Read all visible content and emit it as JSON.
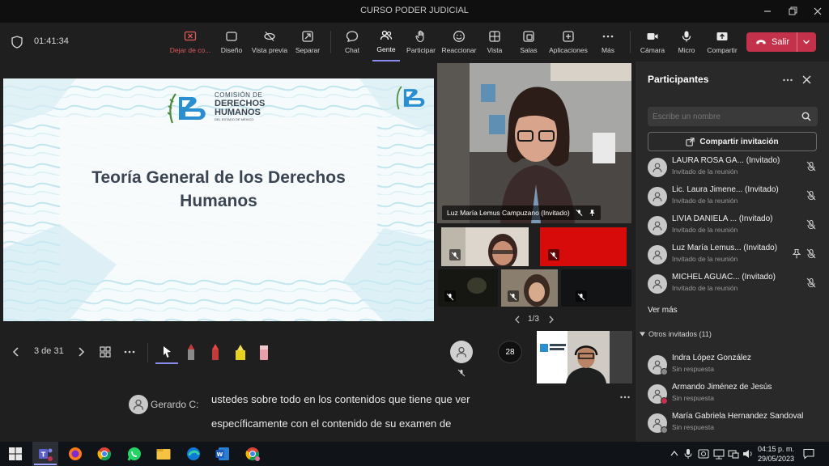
{
  "window": {
    "title": "CURSO PODER JUDICIAL"
  },
  "toolbar": {
    "timer": "01:41:34",
    "stop_share": "Dejar de co...",
    "layout": "Diseño",
    "preview": "Vista previa",
    "separate": "Separar",
    "chat": "Chat",
    "people": "Gente",
    "participate": "Participar",
    "react": "Reaccionar",
    "view": "Vista",
    "rooms": "Salas",
    "apps": "Aplicaciones",
    "more": "Más",
    "camera": "Cámara",
    "mic": "Micro",
    "share": "Compartir",
    "leave": "Salir",
    "colors": {
      "accent": "#8b8cf0",
      "leave": "#c4314b",
      "stop": "#e0595c"
    }
  },
  "slide": {
    "logo_line1": "COMISIÓN DE",
    "logo_line2": "DERECHOS",
    "logo_line3": "HUMANOS",
    "logo_line4": "DEL ESTADO DE MÉXICO",
    "title_line1": "Teoría General de los Derechos",
    "title_line2": "Humanos",
    "page": "3 de 31"
  },
  "video": {
    "main_name": "Luz María Lemus Campuzano (Invitado)",
    "page": "1/3",
    "count_badge": "28"
  },
  "caption": {
    "speaker": "Gerardo C:",
    "line1": "ustedes sobre todo en los contenidos que tiene que ver",
    "line2": "específicamente con el contenido de su examen de"
  },
  "panel": {
    "title": "Participantes",
    "search_placeholder": "Escribe un nombre",
    "share_invite": "Compartir invitación",
    "see_more": "Ver más",
    "others_header": "Otros invitados (11)",
    "invited": [
      {
        "name": "LAURA ROSA GA... (Invitado)",
        "sub": "Invitado de la reunión"
      },
      {
        "name": "Lic. Laura Jimene... (Invitado)",
        "sub": "Invitado de la reunión"
      },
      {
        "name": "LIVIA DANIELA ... (Invitado)",
        "sub": "Invitado de la reunión"
      },
      {
        "name": "Luz María Lemus... (Invitado)",
        "sub": "Invitado de la reunión"
      },
      {
        "name": "MICHEL AGUAC... (Invitado)",
        "sub": "Invitado de la reunión"
      }
    ],
    "others": [
      {
        "name": "Indra López González",
        "sub": "Sin respuesta"
      },
      {
        "name": "Armando Jiménez de Jesús",
        "sub": "Sin respuesta"
      },
      {
        "name": "María Gabriela Hernandez Sandoval",
        "sub": "Sin respuesta"
      }
    ]
  },
  "taskbar": {
    "time": "04:15 p. m.",
    "date": "29/05/2023"
  }
}
